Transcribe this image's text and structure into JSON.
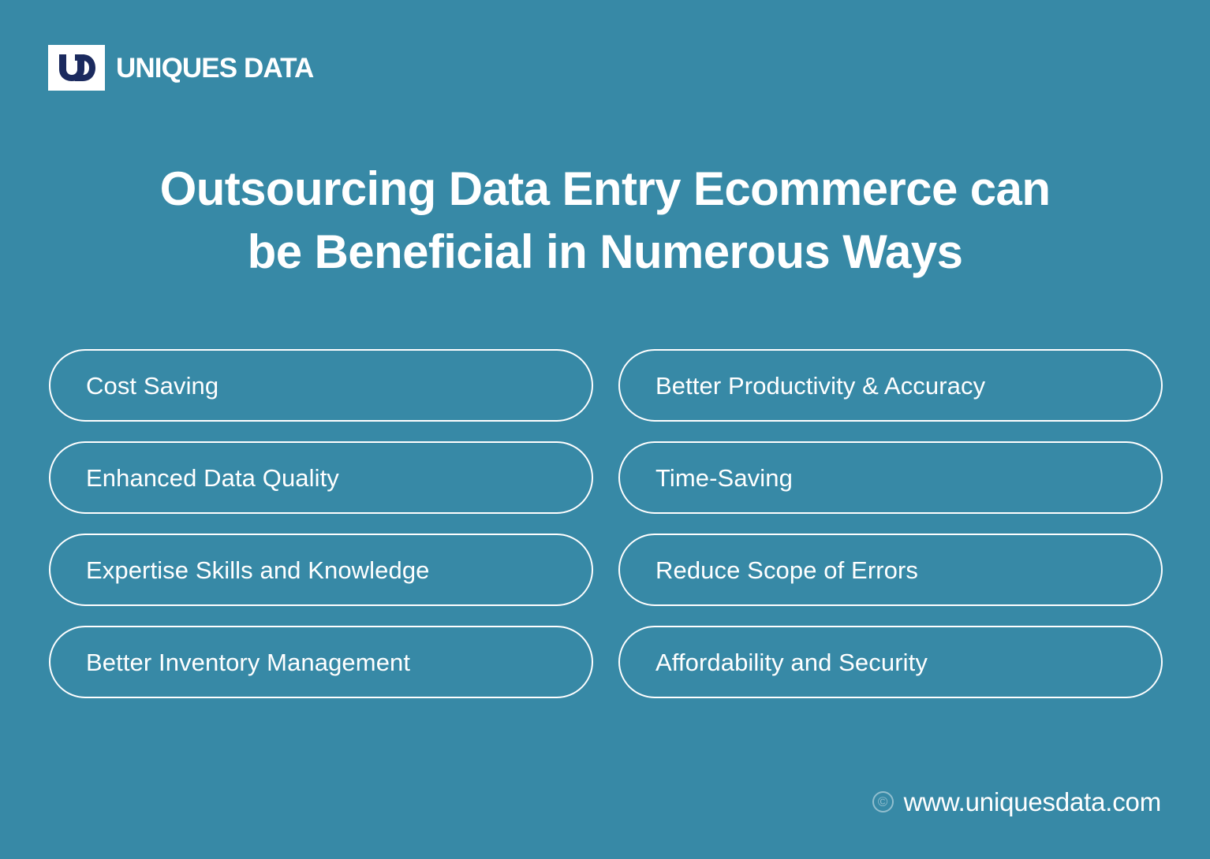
{
  "theme": {
    "background_color": "#3789A6",
    "text_color": "#FFFFFF",
    "logo_mark_color": "#1B2A5E",
    "logo_box_color": "#FFFFFF"
  },
  "brand": {
    "logo_icon": "ud-monogram-icon",
    "name": "UNIQUES DATA"
  },
  "title": {
    "line1": "Outsourcing Data Entry Ecommerce can",
    "line2": "be Beneficial in Numerous Ways"
  },
  "benefits": [
    {
      "label": "Cost Saving"
    },
    {
      "label": "Better Productivity & Accuracy"
    },
    {
      "label": "Enhanced Data Quality"
    },
    {
      "label": "Time-Saving"
    },
    {
      "label": "Expertise Skills and Knowledge"
    },
    {
      "label": "Reduce Scope of Errors"
    },
    {
      "label": "Better Inventory Management"
    },
    {
      "label": "Affordability and Security"
    }
  ],
  "footer": {
    "copyright_symbol": "©",
    "url": "www.uniquesdata.com"
  }
}
